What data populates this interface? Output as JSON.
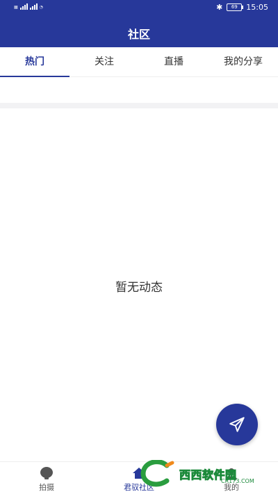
{
  "status_bar": {
    "time": "15:05",
    "battery": "69"
  },
  "header": {
    "title": "社区"
  },
  "tabs": [
    {
      "label": "热门"
    },
    {
      "label": "关注"
    },
    {
      "label": "直播"
    },
    {
      "label": "我的分享"
    }
  ],
  "main": {
    "empty_text": "暂无动态"
  },
  "bottom_nav": [
    {
      "label": "拍摄",
      "icon": "camera-icon"
    },
    {
      "label": "君驭社区",
      "icon": "home-icon"
    },
    {
      "label": "我的",
      "icon": "profile-icon"
    }
  ],
  "watermark": {
    "text": "西西软件园",
    "sub": "CR173.COM"
  },
  "colors": {
    "primary": "#27389a",
    "text": "#333333"
  }
}
